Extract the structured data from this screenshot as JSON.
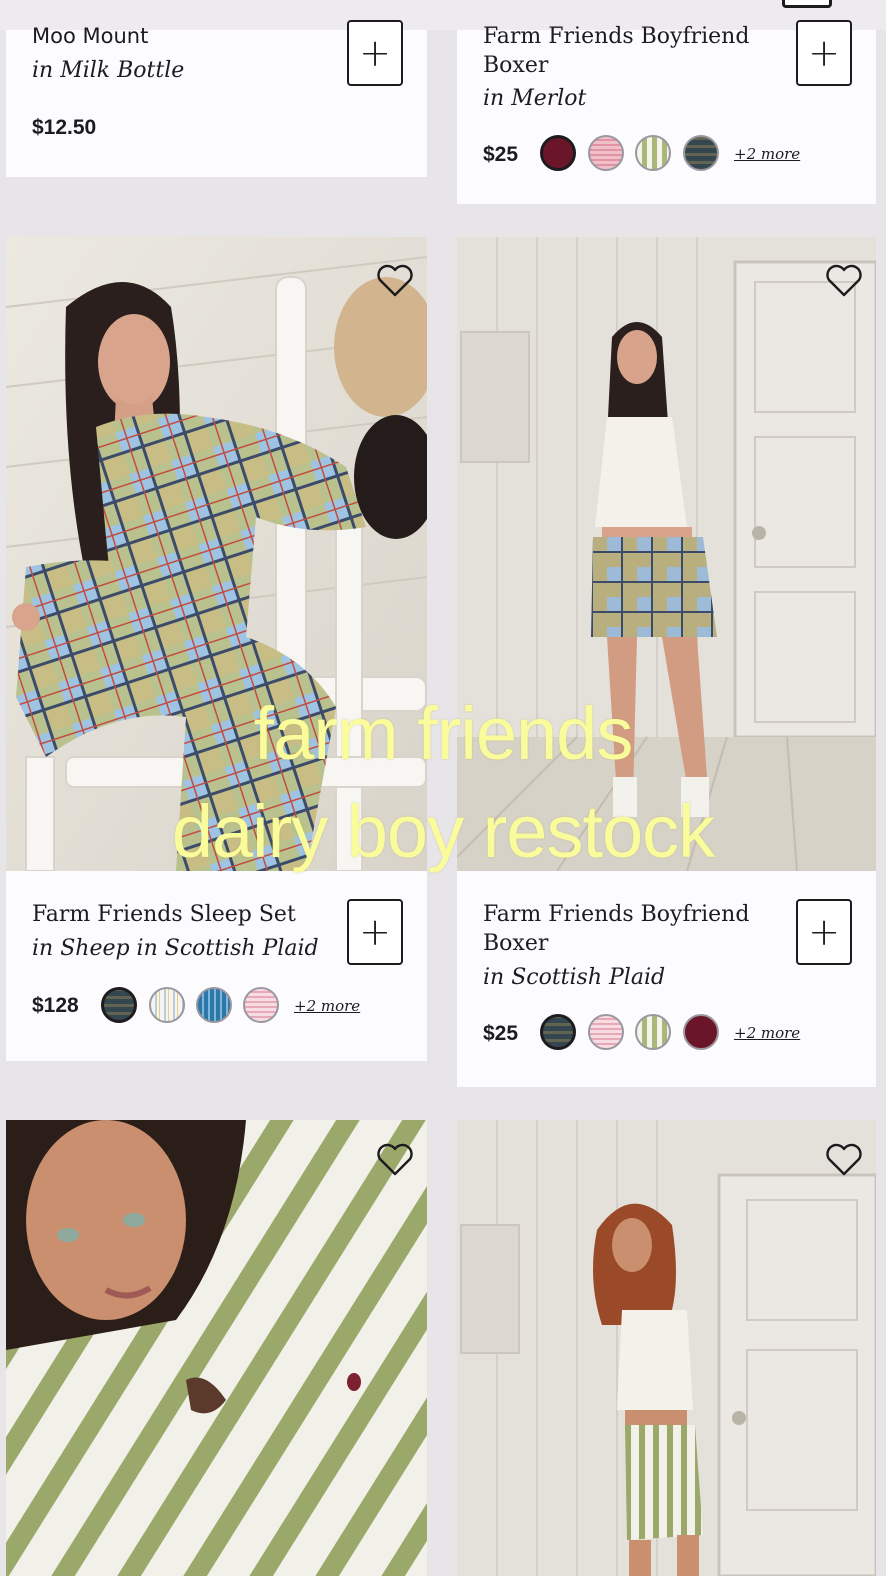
{
  "colors": {
    "page_bg": "#e8e5e9",
    "card_bg": "#fcfbfd",
    "overlay_text": "#fafc9c",
    "merlot": "#6a1628",
    "gingham_pink": "#f1c9d1",
    "olive_stripe": "#a8b77a",
    "scottish_plaid": "#7b8e92",
    "ticking_stripe": "#c8d8e4",
    "blue_stripe": "#3f86b5"
  },
  "products": [
    {
      "title": "Moo Mount",
      "variant": "in Milk Bottle",
      "price": "$12.50",
      "swatches": [],
      "more": ""
    },
    {
      "title": "Farm Friends Boyfriend Boxer",
      "variant": "in Merlot",
      "price": "$25",
      "swatches": [
        "merlot-swatch",
        "gingham-pink-swatch",
        "olive-stripe-swatch",
        "scottish-plaid-swatch"
      ],
      "more": "+2 more"
    },
    {
      "title": "Farm Friends Sleep Set",
      "variant": "in Sheep in Scottish Plaid",
      "price": "$128",
      "swatches": [
        "scottish-plaid-swatch",
        "ticking-stripe-swatch",
        "blue-stripe-swatch",
        "gingham-pink-swatch"
      ],
      "more": "+2 more"
    },
    {
      "title": "Farm Friends Boyfriend Boxer",
      "variant": "in Scottish Plaid",
      "price": "$25",
      "swatches": [
        "scottish-plaid-swatch",
        "gingham-pink-swatch",
        "olive-stripe-swatch",
        "merlot-swatch"
      ],
      "more": "+2 more"
    }
  ],
  "overlay": {
    "line1": "farm friends",
    "line2": "dairy boy restock"
  },
  "icons": {
    "add": "plus-icon",
    "wishlist": "heart-icon",
    "cart": "cart-icon"
  }
}
